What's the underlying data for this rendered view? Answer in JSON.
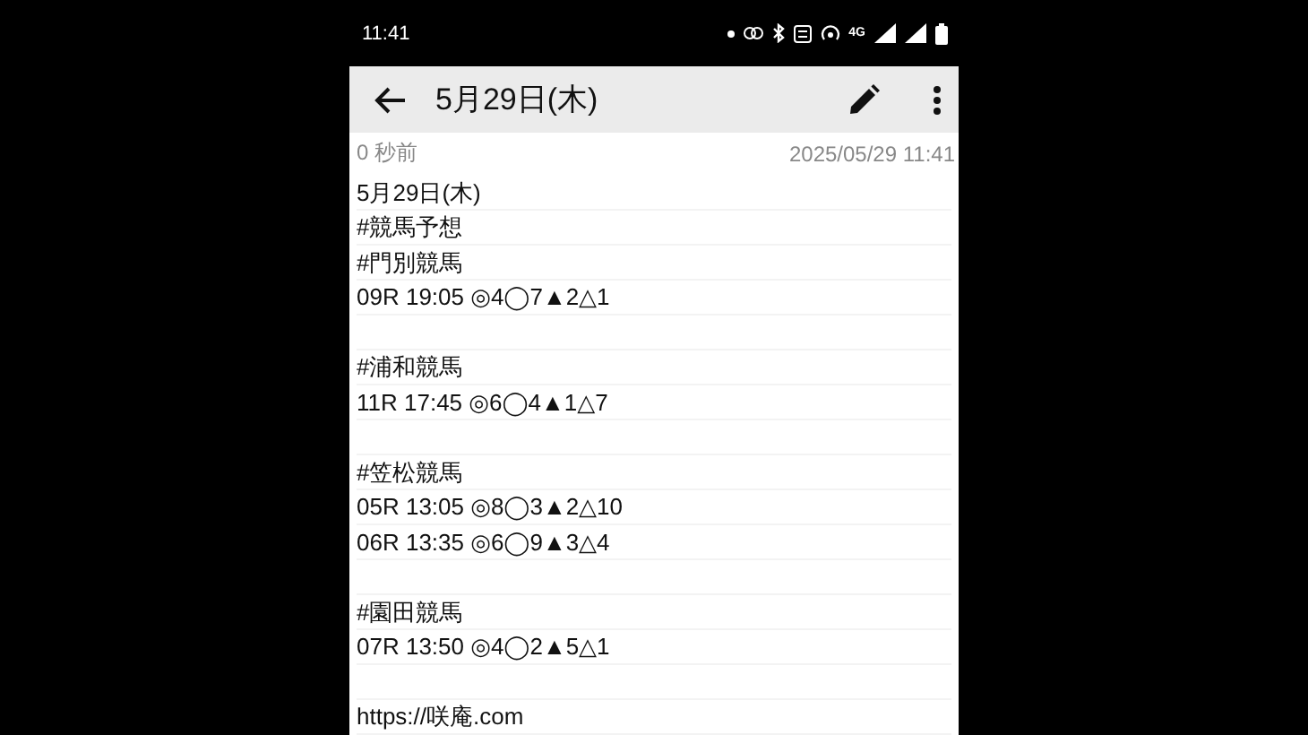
{
  "status_bar": {
    "time": "11:41",
    "network": "4G"
  },
  "toolbar": {
    "title": "5月29日(木)"
  },
  "meta": {
    "relative_time": "0 秒前",
    "timestamp": "2025/05/29 11:41"
  },
  "note_blocks": [
    [
      "5月29日(木)",
      "#競馬予想",
      "#門別競馬",
      "09R 19:05 ◎4◯7▲2△1"
    ],
    [
      "#浦和競馬",
      "11R 17:45 ◎6◯4▲1△7"
    ],
    [
      "#笠松競馬",
      "05R 13:05 ◎8◯3▲2△10",
      "06R 13:35 ◎6◯9▲3△4"
    ],
    [
      "#園田競馬",
      "07R 13:50 ◎4◯2▲5△1"
    ],
    [
      "https://咲庵.com"
    ]
  ]
}
